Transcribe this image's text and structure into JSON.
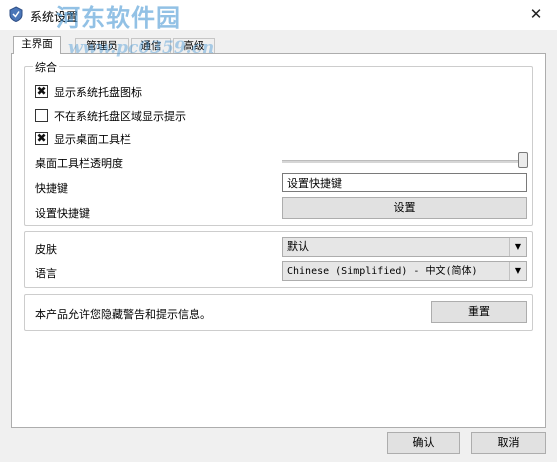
{
  "window": {
    "title": "系统设置",
    "close_glyph": "✕"
  },
  "watermark": {
    "brand": "河东软件园",
    "url": "www.pc0359.cn"
  },
  "tabs": [
    "主界面",
    "管理员",
    "通信",
    "高级"
  ],
  "general": {
    "group_title": "综合",
    "options": [
      {
        "label": "显示系统托盘图标",
        "checked": true,
        "mark": "✖"
      },
      {
        "label": "不在系统托盘区域显示提示",
        "checked": false,
        "mark": ""
      },
      {
        "label": "显示桌面工具栏",
        "checked": true,
        "mark": "✖"
      }
    ],
    "opacity": {
      "label": "桌面工具栏透明度",
      "value": 1.0
    },
    "hotkey": {
      "label": "快捷键",
      "value": "设置快捷键"
    },
    "set_hotkey": {
      "label": "设置快捷键",
      "button": "设置"
    }
  },
  "appearance": {
    "skin": {
      "label": "皮肤",
      "value": "默认"
    },
    "language": {
      "label": "语言",
      "value": "Chinese (Simplified) - 中文(简体)"
    }
  },
  "warnings": {
    "text": "本产品允许您隐藏警告和提示信息。",
    "reset_button": "重置"
  },
  "footer": {
    "ok": "确认",
    "cancel": "取消"
  },
  "colors": {
    "accent": "#3a8fd0",
    "window_bg": "#f0f0f0"
  }
}
